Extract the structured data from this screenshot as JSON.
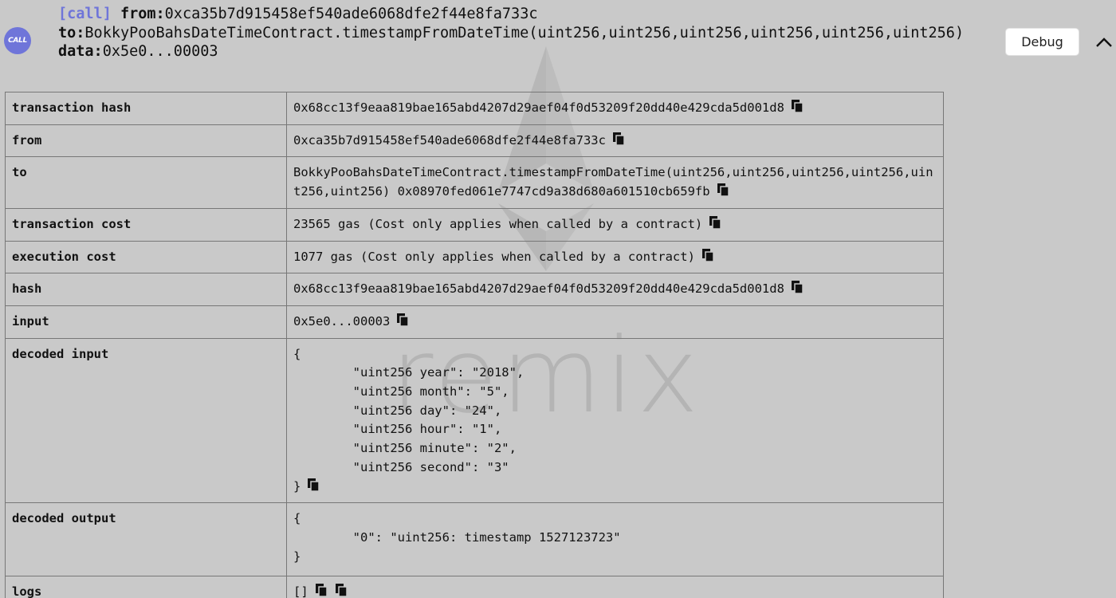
{
  "header": {
    "call_tag": "[call]",
    "from_key": "from:",
    "from_value": "0xca35b7d915458ef540ade6068dfe2f44e8fa733c",
    "to_key": "to:",
    "to_value": "BokkyPooBahsDateTimeContract.timestampFromDateTime(uint256,uint256,uint256,uint256,uint256,uint256)",
    "data_key": "data:",
    "data_value": "0x5e0...00003",
    "badge_label": "CALL",
    "debug_label": "Debug"
  },
  "watermark": {
    "text": "remix"
  },
  "rows": [
    {
      "label": "transaction hash",
      "value": "0x68cc13f9eaa819bae165abd4207d29aef04f0d53209f20dd40e429cda5d001d8"
    },
    {
      "label": "from",
      "value": "0xca35b7d915458ef540ade6068dfe2f44e8fa733c"
    },
    {
      "label": "to",
      "value": "BokkyPooBahsDateTimeContract.timestampFromDateTime(uint256,uint256,uint256,uint256,uint256,uint256) 0x08970fed061e7747cd9a38d680a601510cb659fb"
    },
    {
      "label": "transaction cost",
      "value": "23565 gas (Cost only applies when called by a contract)"
    },
    {
      "label": "execution cost",
      "value": "1077 gas (Cost only applies when called by a contract)"
    },
    {
      "label": "hash",
      "value": "0x68cc13f9eaa819bae165abd4207d29aef04f0d53209f20dd40e429cda5d001d8"
    },
    {
      "label": "input",
      "value": "0x5e0...00003"
    },
    {
      "label": "decoded input",
      "value": "{\n\t\"uint256 year\": \"2018\",\n\t\"uint256 month\": \"5\",\n\t\"uint256 day\": \"24\",\n\t\"uint256 hour\": \"1\",\n\t\"uint256 minute\": \"2\",\n\t\"uint256 second\": \"3\"\n}"
    },
    {
      "label": "decoded output",
      "value": "{\n\t\"0\": \"uint256: timestamp 1527123723\"\n}"
    },
    {
      "label": "logs",
      "value": "[]"
    }
  ],
  "icons": {
    "copy": "copy-icon",
    "collapse": "chevron-up-icon"
  }
}
